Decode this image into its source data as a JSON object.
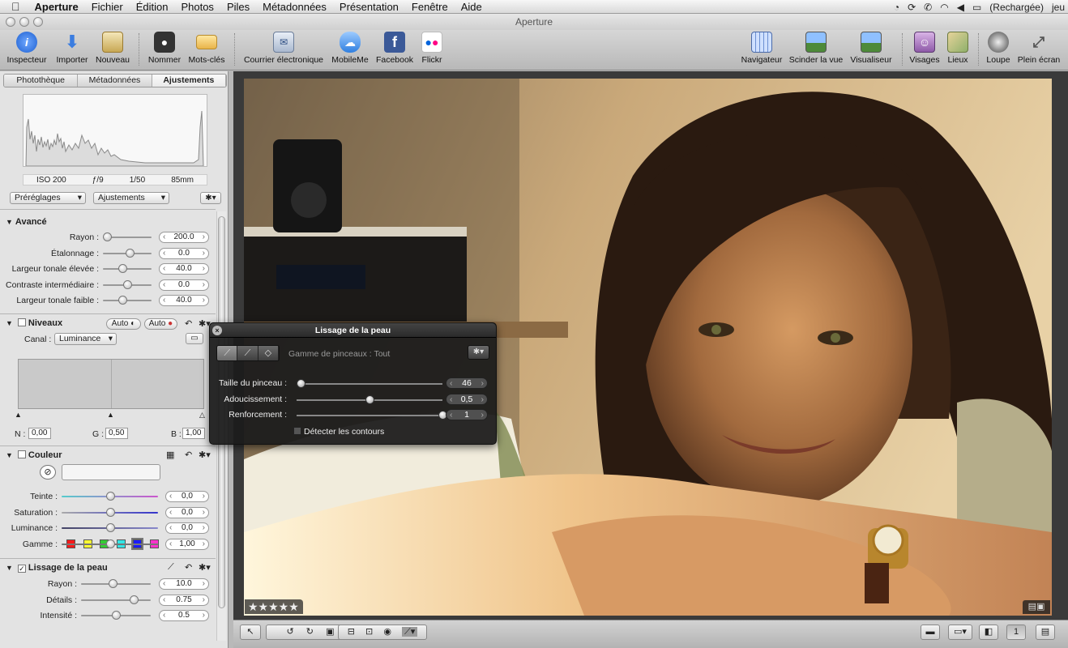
{
  "menubar": {
    "apple": "",
    "app": "Aperture",
    "items": [
      "Fichier",
      "Édition",
      "Photos",
      "Piles",
      "Métadonnées",
      "Présentation",
      "Fenêtre",
      "Aide"
    ],
    "battery": "(Rechargée)",
    "user": "jeu"
  },
  "window": {
    "title": "Aperture"
  },
  "toolbar": {
    "inspector": "Inspecteur",
    "import": "Importer",
    "new": "Nouveau",
    "name": "Nommer",
    "keywords": "Mots-clés",
    "email": "Courrier électronique",
    "mobileme": "MobileMe",
    "facebook": "Facebook",
    "flickr": "Flickr",
    "navigator": "Navigateur",
    "split": "Scinder la vue",
    "viewer": "Visualiseur",
    "faces": "Visages",
    "places": "Lieux",
    "loupe": "Loupe",
    "fullscreen": "Plein écran"
  },
  "inspector": {
    "tabs": [
      "Photothèque",
      "Métadonnées",
      "Ajustements"
    ],
    "active_tab": "Ajustements",
    "exif": {
      "iso": "ISO 200",
      "aperture": "ƒ/9",
      "shutter": "1/50",
      "focal": "85mm"
    },
    "presets_label": "Préréglages",
    "adjustments_label": "Ajustements",
    "gear": "✱▾"
  },
  "advanced": {
    "title": "Avancé",
    "rows": [
      {
        "label": "Rayon :",
        "value": "200.0",
        "fraction": 0.08
      },
      {
        "label": "Étalonnage :",
        "value": "0.0",
        "fraction": 0.55
      },
      {
        "label": "Largeur tonale élevée :",
        "value": "40.0",
        "fraction": 0.4
      },
      {
        "label": "Contraste intermédiaire :",
        "value": "0.0",
        "fraction": 0.5
      },
      {
        "label": "Largeur tonale faible :",
        "value": "40.0",
        "fraction": 0.4
      }
    ]
  },
  "levels": {
    "title": "Niveaux",
    "auto1": "Auto",
    "auto2": "Auto",
    "channel_label": "Canal :",
    "channel_value": "Luminance",
    "n_label": "N :",
    "n_value": "0,00",
    "g_label": "G :",
    "g_value": "0,50",
    "b_label": "B :",
    "b_value": "1,00"
  },
  "color": {
    "title": "Couleur",
    "swatches": [
      "#ff1a1a",
      "#ffff33",
      "#33cc33",
      "#33e6e6",
      "#1a1aff",
      "#ff33cc"
    ],
    "rows": [
      {
        "label": "Teinte :",
        "value": "0,0",
        "fraction": 0.5
      },
      {
        "label": "Saturation :",
        "value": "0,0",
        "fraction": 0.5
      },
      {
        "label": "Luminance :",
        "value": "0,0",
        "fraction": 0.5
      },
      {
        "label": "Gamme :",
        "value": "1,00",
        "fraction": 0.5
      }
    ]
  },
  "skin": {
    "title": "Lissage de la peau",
    "rows": [
      {
        "label": "Rayon :",
        "value": "10.0",
        "fraction": 0.45
      },
      {
        "label": "Détails :",
        "value": "0.75",
        "fraction": 0.75
      },
      {
        "label": "Intensité :",
        "value": "0.5",
        "fraction": 0.5
      }
    ]
  },
  "hud": {
    "title": "Lissage de la peau",
    "brush_range": "Gamme de pinceaux : Tout",
    "size_label": "Taille du pinceau :",
    "size_value": "46",
    "size_fraction": 0.03,
    "softness_label": "Adoucissement :",
    "softness_value": "0,5",
    "softness_fraction": 0.5,
    "strength_label": "Renforcement :",
    "strength_value": "1",
    "strength_fraction": 1.0,
    "detect_edges": "Détecter les contours"
  },
  "viewer": {
    "rating": "★★★★★"
  }
}
